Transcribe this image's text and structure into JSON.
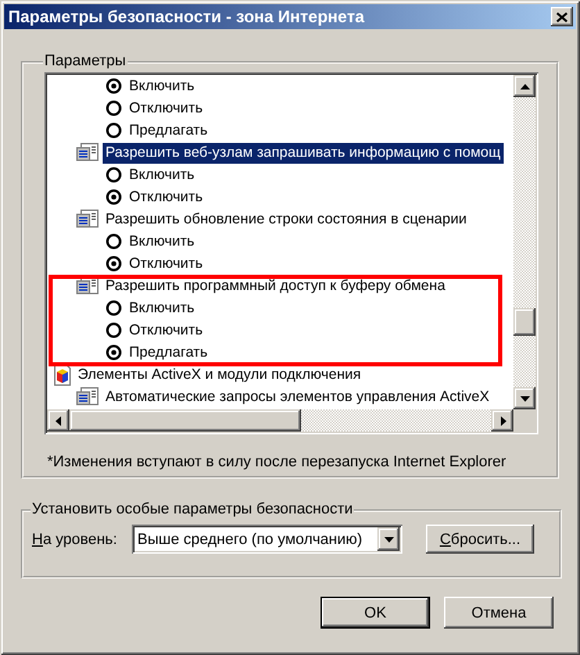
{
  "window": {
    "title": "Параметры безопасности - зона Интернета"
  },
  "settings_group": {
    "title": "Параметры",
    "tree": {
      "items": [
        {
          "kind": "option",
          "label": "Включить",
          "selected": true
        },
        {
          "kind": "option",
          "label": "Отключить",
          "selected": false
        },
        {
          "kind": "option",
          "label": "Предлагать",
          "selected": false
        },
        {
          "kind": "setting",
          "label": "Разрешить веб-узлам запрашивать информацию с помощ",
          "selected": true,
          "children": [
            {
              "kind": "option",
              "label": "Включить",
              "selected": false
            },
            {
              "kind": "option",
              "label": "Отключить",
              "selected": true
            }
          ]
        },
        {
          "kind": "setting",
          "label": "Разрешить обновление строки состояния в сценарии",
          "selected": false,
          "children": [
            {
              "kind": "option",
              "label": "Включить",
              "selected": false
            },
            {
              "kind": "option",
              "label": "Отключить",
              "selected": true
            }
          ]
        },
        {
          "kind": "setting",
          "label": "Разрешить программный доступ к буферу обмена",
          "selected": false,
          "children": [
            {
              "kind": "option",
              "label": "Включить",
              "selected": false
            },
            {
              "kind": "option",
              "label": "Отключить",
              "selected": false
            },
            {
              "kind": "option",
              "label": "Предлагать",
              "selected": true
            }
          ]
        },
        {
          "kind": "category",
          "label": "Элементы ActiveX и модули подключения",
          "selected": false,
          "children": [
            {
              "kind": "setting",
              "label": "Автоматические запросы элементов управления ActiveX",
              "selected": false
            }
          ]
        }
      ]
    },
    "annotation": {
      "kind": "rectangle"
    },
    "note": "*Изменения вступают в силу после перезапуска Internet Explorer"
  },
  "custom_group": {
    "title": "Установить особые параметры безопасности",
    "level_label": {
      "text": "На уровень:",
      "access_key_underlined": true
    },
    "level_dropdown": {
      "value": "Выше среднего (по умолчанию)"
    },
    "reset_button": {
      "text": "Сбросить...",
      "access_key_underlined": true
    }
  },
  "buttons": [
    {
      "text": "OK",
      "default": true
    },
    {
      "text": "Отмена",
      "default": false
    }
  ]
}
